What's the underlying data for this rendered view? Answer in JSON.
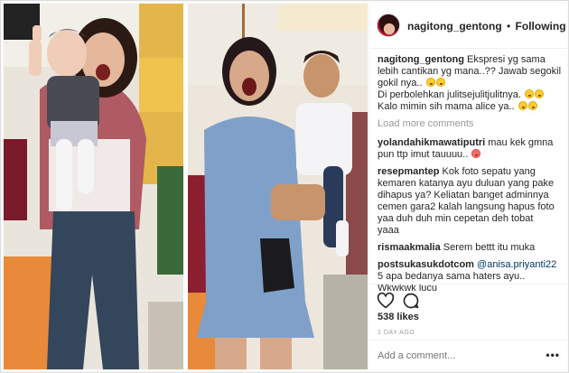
{
  "post": {
    "header": {
      "username": "nagitong_gentong",
      "separator": "•",
      "follow_status": "Following"
    },
    "caption": {
      "username": "nagitong_gentong",
      "lines": [
        "Ekspresi yg sama",
        "lebih cantikan yg mana..?? Jawab segokil",
        "gokil nya..",
        "Di perbolehkan julitsejulitjulitnya.",
        "Kalo mimin sih mama alice ya.."
      ]
    },
    "load_more": "Load more comments",
    "comments": [
      {
        "username": "yolandahikmawatiputri",
        "lines": [
          "mau kek gmna",
          "pun ttp imut tauuuu.."
        ]
      },
      {
        "username": "resepmantep",
        "lines": [
          "Kok foto sepatu yang",
          "kemaren katanya ayu duluan yang pake",
          "dihapus ya? Keliatan banget adminnya",
          "cemen gara2 kalah langsung hapus foto",
          "yaa duh duh min cepetan deh tobat",
          "yaaa"
        ]
      },
      {
        "username": "rismaakmalia",
        "lines": [
          "Serem bettt itu muka"
        ]
      },
      {
        "username": "postsukasukdotcom",
        "mention": "@anisa.priyanti22",
        "lines": [
          "5 apa bedanya sama haters ayu..",
          "Wkwkwk lucu"
        ]
      }
    ],
    "likes": "538 likes",
    "time_ago": "1 DAY AGO",
    "add_comment_placeholder": "Add a comment...",
    "more_label": "•••"
  },
  "icons": {
    "like": "heart-icon",
    "comment": "comment-bubble-icon",
    "emoji": "emoji-icon"
  },
  "colors": {
    "border": "#dbdbdb",
    "muted": "#999999",
    "text": "#262626",
    "mention": "#003569"
  }
}
